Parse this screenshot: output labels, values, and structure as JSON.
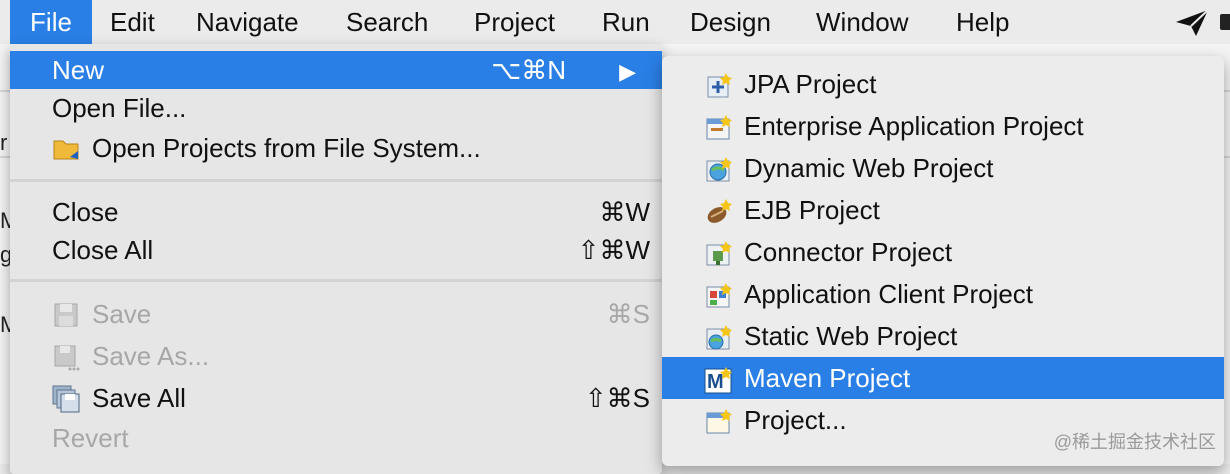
{
  "menubar": {
    "items": [
      "File",
      "Edit",
      "Navigate",
      "Search",
      "Project",
      "Run",
      "Design",
      "Window",
      "Help"
    ]
  },
  "background_chars": [
    "r",
    "M",
    "gi",
    "Ma"
  ],
  "file_menu": {
    "new": {
      "label": "New",
      "shortcut": "⌥⌘N"
    },
    "open_file": {
      "label": "Open File..."
    },
    "open_projects": {
      "label": "Open Projects from File System..."
    },
    "close": {
      "label": "Close",
      "shortcut": "⌘W"
    },
    "close_all": {
      "label": "Close All",
      "shortcut": "⇧⌘W"
    },
    "save": {
      "label": "Save",
      "shortcut": "⌘S"
    },
    "save_as": {
      "label": "Save As..."
    },
    "save_all": {
      "label": "Save All",
      "shortcut": "⇧⌘S"
    },
    "revert": {
      "label": "Revert"
    }
  },
  "submenu": {
    "items": [
      {
        "label": "JPA Project",
        "icon": "jpa-project-icon"
      },
      {
        "label": "Enterprise Application Project",
        "icon": "ear-project-icon"
      },
      {
        "label": "Dynamic Web Project",
        "icon": "dynamic-web-icon"
      },
      {
        "label": "EJB Project",
        "icon": "ejb-project-icon"
      },
      {
        "label": "Connector Project",
        "icon": "connector-project-icon"
      },
      {
        "label": "Application Client Project",
        "icon": "app-client-icon"
      },
      {
        "label": "Static Web Project",
        "icon": "static-web-icon"
      },
      {
        "label": "Maven Project",
        "icon": "maven-project-icon"
      },
      {
        "label": "Project...",
        "icon": "project-icon"
      }
    ]
  },
  "colors": {
    "highlight": "#2a7fe6"
  },
  "watermark": "@稀土掘金技术社区"
}
